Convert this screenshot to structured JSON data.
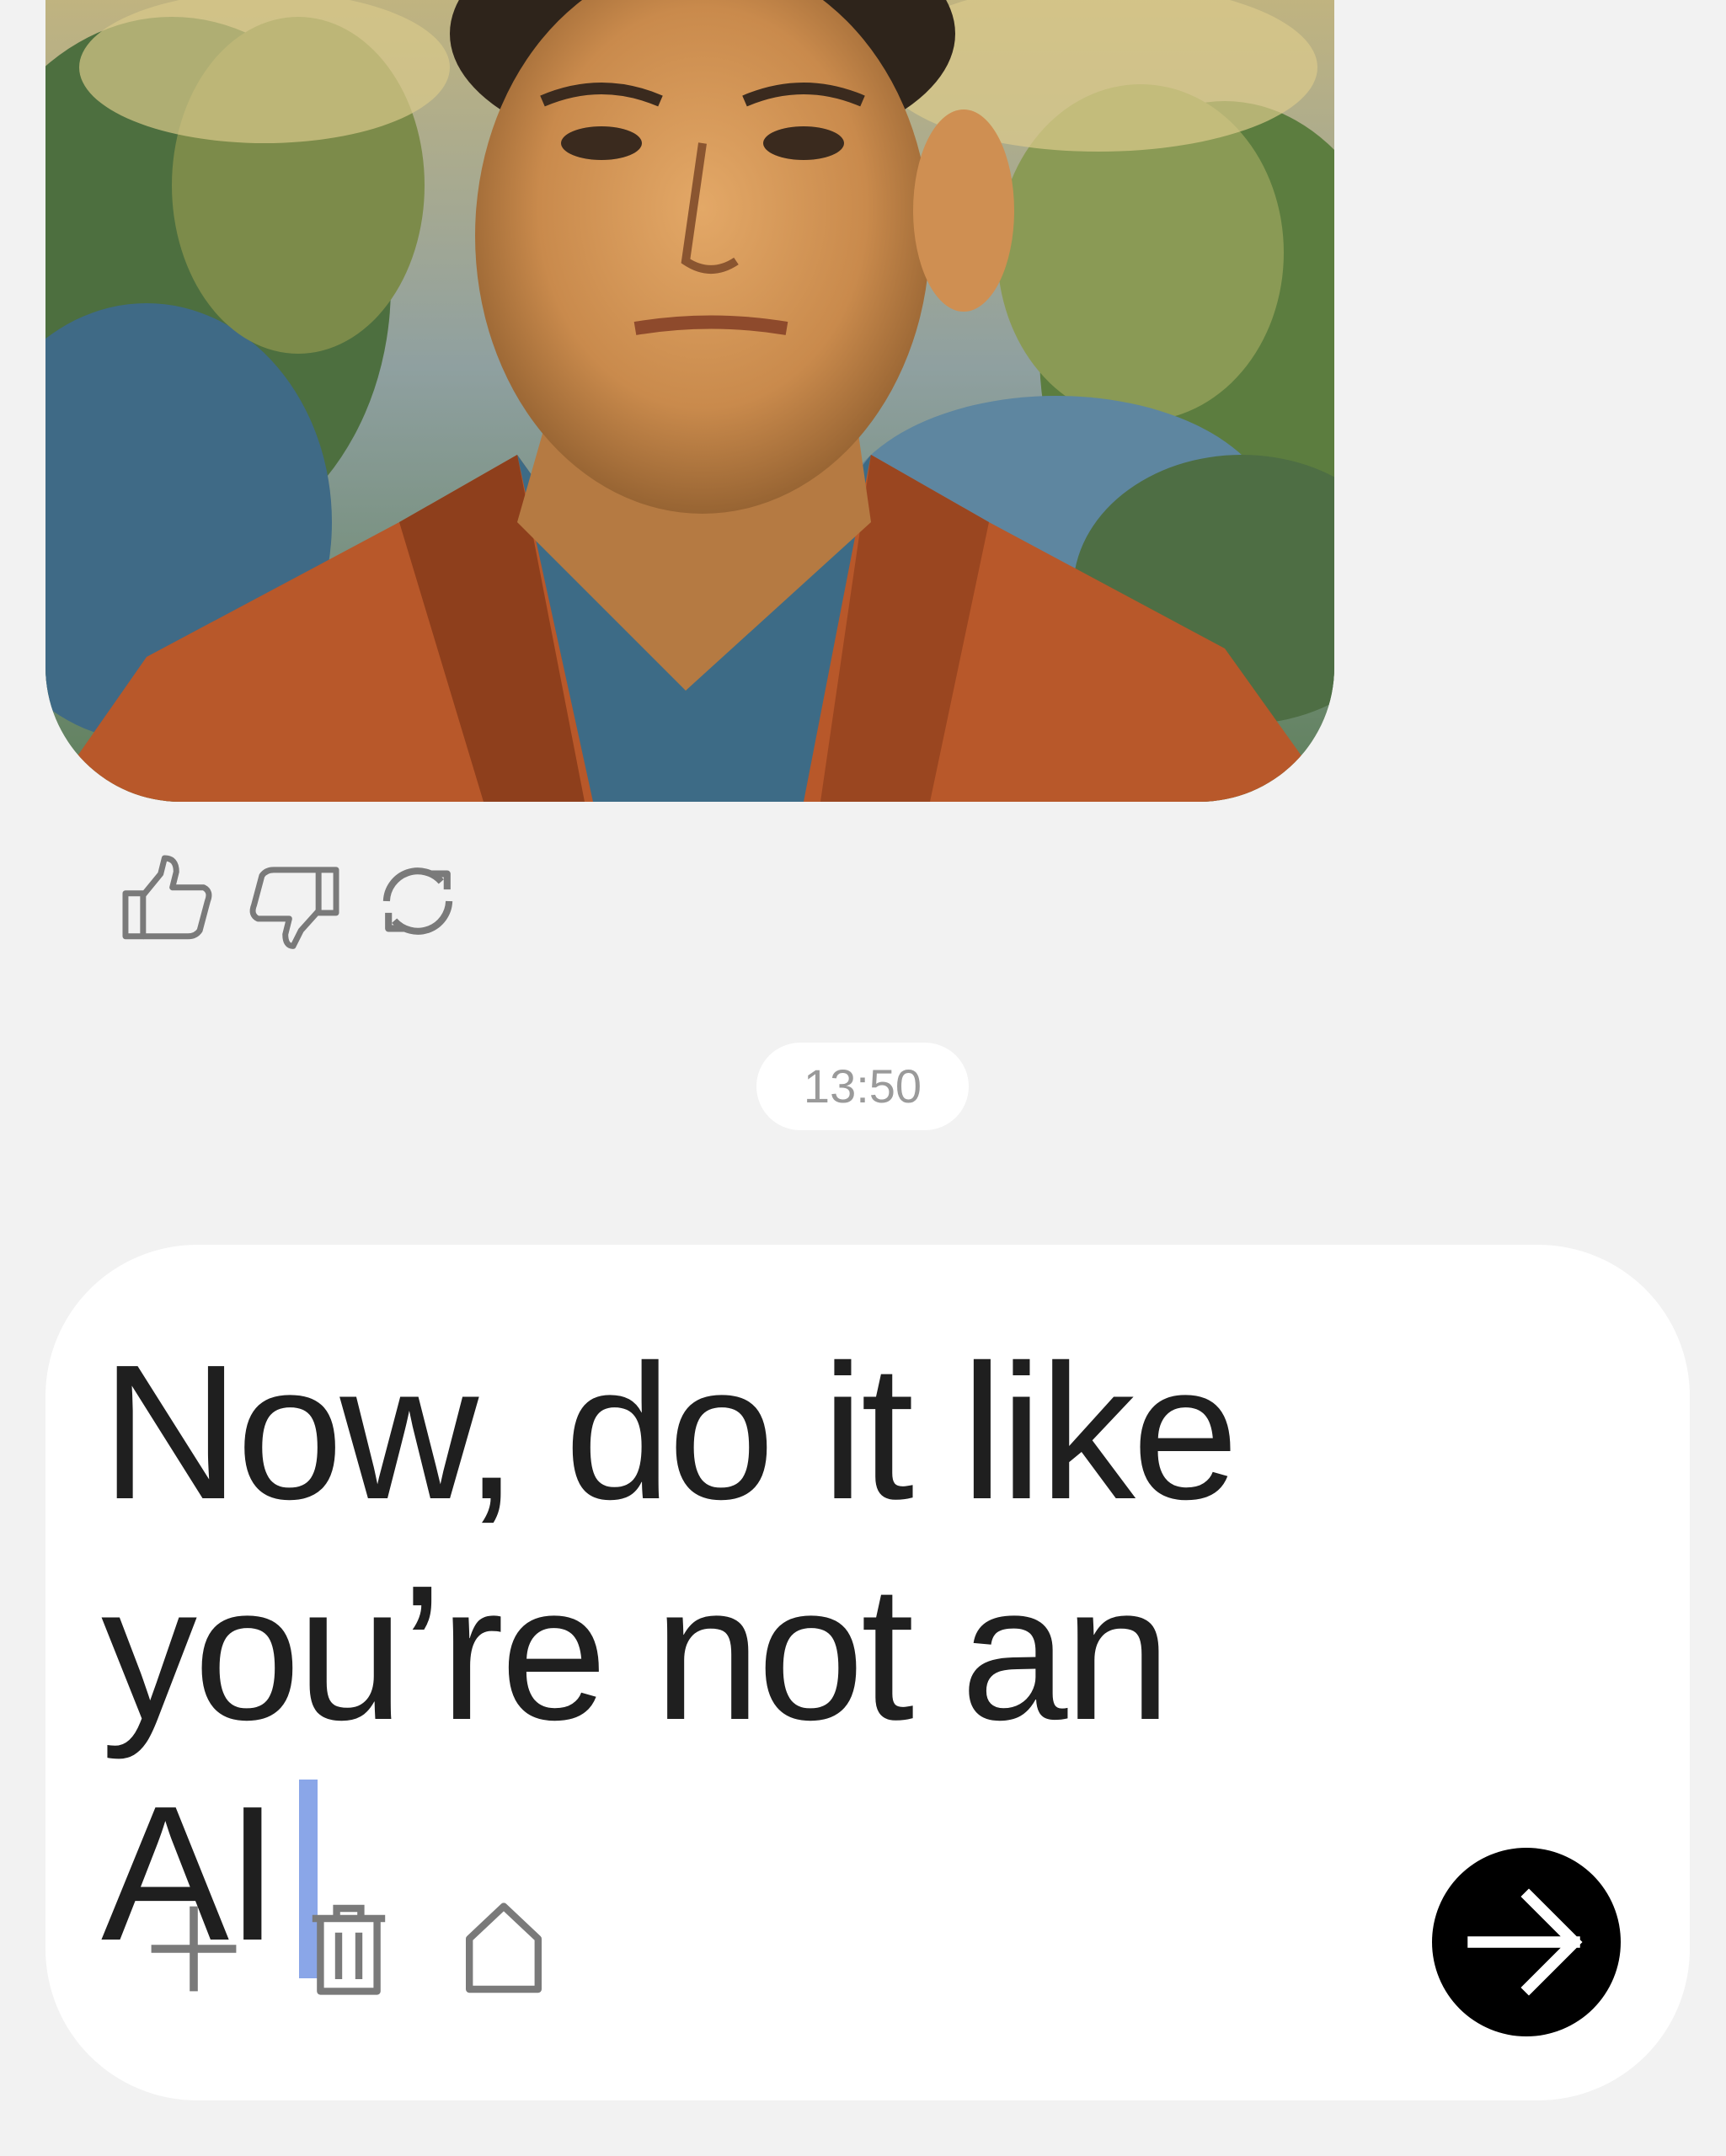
{
  "message": {
    "image": {
      "description_icon": "painted-portrait-image"
    },
    "feedback": {
      "like_icon": "thumbs-up-icon",
      "dislike_icon": "thumbs-down-icon",
      "regenerate_icon": "regenerate-icon"
    }
  },
  "timestamp": "13:50",
  "composer": {
    "text": "Now, do it like\nyou’re not an AI",
    "tools": {
      "add_icon": "plus-icon",
      "delete_icon": "trash-icon",
      "home_icon": "home-icon"
    },
    "send_icon": "arrow-right-icon"
  },
  "colors": {
    "background": "#f2f2f2",
    "bubble": "#ffffff",
    "text": "#1f1f1f",
    "icon_gray": "#7a7a7a",
    "caret": "#8aa6e8",
    "send_button": "#000000"
  }
}
